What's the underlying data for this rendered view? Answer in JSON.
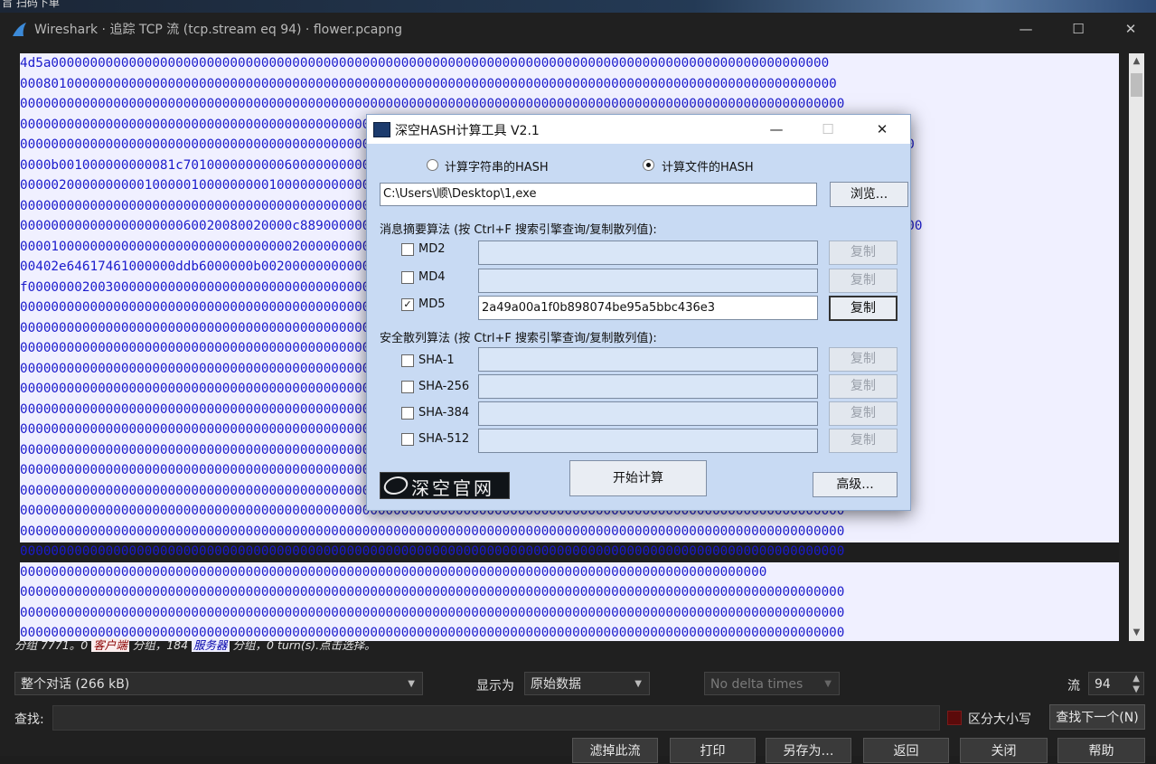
{
  "desktop_strip_text": "旨 扫码下单",
  "window": {
    "title": "Wireshark · 追踪 TCP 流 (tcp.stream eq 94) · flower.pcapng",
    "min": "—",
    "max": "☐",
    "close": "✕"
  },
  "stream_lines": [
    "4d5a0000000000000000000000000000000000000000000000000000000000000000000000000000000000000000000000000000",
    "000801000000000000000000000000000000000000000000000000000000000000000000000000000000000000000000000000000",
    "0000000000000000000000000000000000000000000000000000000000000000000000000000000000000000000000000000000000",
    "0000000000000000000000000000000000000000000000000000000000000000000000000000000000000000000000000000000000",
    "000000000000000000000000000000000000000000000000000000000000000000000000000000000000000000000e0000f010b010600000000",
    "0000b001000000000081c701000000000060000000000000000000000000000000000000000000000000000000000006004000010000000000",
    "00000200000000001000001000000000100000000000000000000000000000000000000000000000000000000000000300ace5000000000000",
    "0000000000000000000000000000000000000000000000000000000000000000000000000000000000000000000000000000000000",
    "00000000000000000000060020080020000c88900000000000000000000000000000000000000000000000000000724602000010000000500200",
    "0000100000000000000000000000000000020000000000000000000000000000000000000000000000000000000000000000000000040000",
    "00402e64617461000000ddb6000000b002000000000000000000000000000000000000000000000000000000000000ace500000070030000",
    "f000000020030000000000000000000000000000000000000000000000000000000000000000000000000000000000000000000000",
    "0000000000000000000000000000000000000000000000000000000000000000000000000000000000000000000000000000000000",
    "0000000000000000000000000000000000000000000000000000000000000000000000000000000000000000000000000000000000",
    "0000000000000000000000000000000000000000000000000000000000000000000000000000000000000000000000000000000000",
    "0000000000000000000000000000000000000000000000000000000000000000000000000000000000000000000000000000000000",
    "0000000000000000000000000000000000000000000000000000000000000000000000000000000000000000000000000000000000",
    "0000000000000000000000000000000000000000000000000000000000000000000000000000000000000000000000000000000000",
    "0000000000000000000000000000000000000000000000000000000000000000000000000000000000000000000000000000000000",
    "0000000000000000000000000000000000000000000000000000000000000000000000000000000000000000000000000000000000",
    "0000000000000000000000000000000000000000000000000000000000000000000000000000000000000000000000000000000000",
    "0000000000000000000000000000000000000000000000000000000000000000000000000000000000000000000000000000000000",
    "0000000000000000000000000000000000000000000000000000000000000000000000000000000000000000000000000000000000",
    "0000000000000000000000000000000000000000000000000000000000000000000000000000000000000000000000000000000000",
    "0000000000000000000000000000000000000000000000000000000000000000000000000000000000000000000000000000000000",
    "000000000000000000000000000000000000000000000000000000000000000000000000000000000000000000000000",
    "0000000000000000000000000000000000000000000000000000000000000000000000000000000000000000000000000000000000",
    "0000000000000000000000000000000000000000000000000000000000000000000000000000000000000000000000000000000000",
    "0000000000000000000000000000000000000000000000000000000000000000000000000000000000000000000000000000000000"
  ],
  "status": {
    "prefix": "分组 7771。0 ",
    "client": "客户端",
    "middle": " 分组，184 ",
    "server": "服务器",
    "suffix": " 分组，0 turn(s).点击选择。"
  },
  "controls": {
    "conversation": "整个对话 (266 kB)",
    "show_as_label": "显示为",
    "show_as_value": "原始数据",
    "delta": "No delta times",
    "stream_label": "流",
    "stream_value": "94",
    "find_label": "查找:",
    "case_label": "区分大小写",
    "find_next": "查找下一个(N)"
  },
  "bottom_buttons": [
    "滤掉此流",
    "打印",
    "另存为…",
    "返回",
    "关闭",
    "帮助"
  ],
  "dialog": {
    "title": "深空HASH计算工具 V2.1",
    "min": "—",
    "max": "☐",
    "close": "✕",
    "radio_string": "计算字符串的HASH",
    "radio_file": "计算文件的HASH",
    "path": "C:\\Users\\顺\\Desktop\\1,exe",
    "browse": "浏览...",
    "digest_heading": "消息摘要算法 (按 Ctrl+F 搜索引擎查询/复制散列值):",
    "secure_heading": "安全散列算法 (按 Ctrl+F 搜索引擎查询/复制散列值):",
    "algos": [
      {
        "name": "MD2",
        "checked": false,
        "value": "",
        "copy": "复制"
      },
      {
        "name": "MD4",
        "checked": false,
        "value": "",
        "copy": "复制"
      },
      {
        "name": "MD5",
        "checked": true,
        "value": "2a49a00a1f0b898074be95a5bbc436e3",
        "copy": "复制"
      },
      {
        "name": "SHA-1",
        "checked": false,
        "value": "",
        "copy": "复制"
      },
      {
        "name": "SHA-256",
        "checked": false,
        "value": "",
        "copy": "复制"
      },
      {
        "name": "SHA-384",
        "checked": false,
        "value": "",
        "copy": "复制"
      },
      {
        "name": "SHA-512",
        "checked": false,
        "value": "",
        "copy": "复制"
      }
    ],
    "logo_text": "深空官网",
    "start": "开始计算",
    "advanced": "高级..."
  }
}
